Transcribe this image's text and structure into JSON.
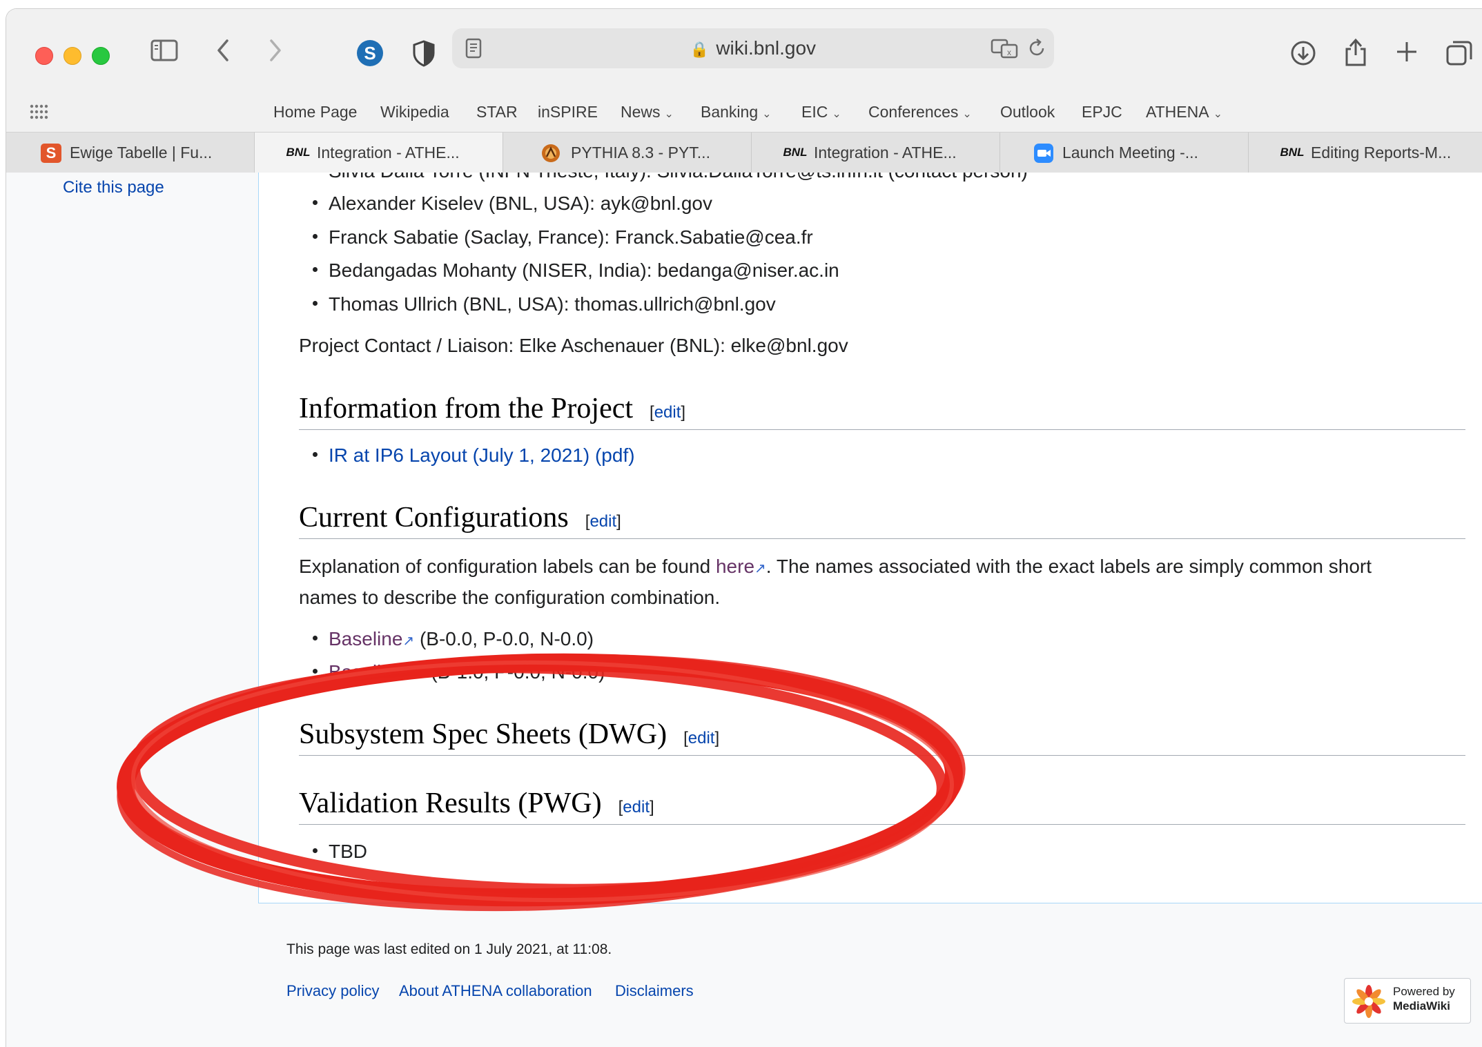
{
  "browser": {
    "url": "wiki.bnl.gov",
    "bookmarks": [
      "Home Page",
      "Wikipedia",
      "STAR",
      "inSPIRE",
      "News",
      "Banking",
      "EIC",
      "Conferences",
      "Outlook",
      "EPJC",
      "ATHENA"
    ],
    "tabs": [
      {
        "label": "Ewige Tabelle | Fu...",
        "icon": "s-icon"
      },
      {
        "label": "Integration - ATHE...",
        "icon": "bnl-icon"
      },
      {
        "label": "PYTHIA 8.3 - PYT...",
        "icon": "pythia-icon"
      },
      {
        "label": "Integration - ATHE...",
        "icon": "bnl-icon"
      },
      {
        "label": "Launch Meeting -...",
        "icon": "zoom-icon"
      },
      {
        "label": "Editing Reports-M...",
        "icon": "bnl-icon"
      }
    ]
  },
  "sidebar": {
    "cite": "Cite this page"
  },
  "article": {
    "partial_top": "Silvia Dalla Torre (INFN Trieste, Italy): Silvia.DallaTorre@ts.infn.it (contact person)",
    "contacts": [
      "Alexander Kiselev (BNL, USA): ayk@bnl.gov",
      "Franck Sabatie (Saclay, France): Franck.Sabatie@cea.fr",
      "Bedangadas Mohanty (NISER, India): bedanga@niser.ac.in",
      "Thomas Ullrich (BNL, USA): thomas.ullrich@bnl.gov"
    ],
    "liaison": "Project Contact / Liaison: Elke Aschenauer (BNL): elke@bnl.gov",
    "edit_label": "edit",
    "sec_info": "Information from the Project",
    "info_link": "IR at IP6 Layout (July 1, 2021) (pdf)",
    "sec_config": "Current Configurations",
    "config_para_1a": "Explanation of configuration labels can be found ",
    "config_here": "here",
    "config_para_1b": ". The names associated with the exact labels are simply common short",
    "config_para_2": "names to describe the configuration combination.",
    "config_items": [
      {
        "link": "Baseline",
        "text": "(B-0.0, P-0.0, N-0.0)"
      },
      {
        "link": "Baseline+",
        "text": "(B-1.0, P-0.0, N-0.0)"
      }
    ],
    "sec_subsystem": "Subsystem Spec Sheets (DWG)",
    "sec_validation": "Validation Results (PWG)",
    "tbd": "TBD"
  },
  "footer": {
    "last_edited": "This page was last edited on 1 July 2021, at 11:08.",
    "links": [
      "Privacy policy",
      "About ATHENA collaboration",
      "Disclaimers"
    ],
    "powered_line1": "Powered by",
    "powered_line2": "MediaWiki"
  },
  "annotation_color": "#e8241c"
}
